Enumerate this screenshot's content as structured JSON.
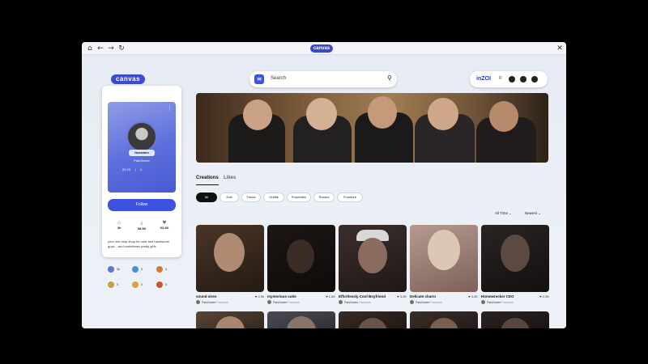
{
  "titlebar": {
    "home_icon": "home-icon",
    "back_icon": "arrow-left-icon",
    "forward_icon": "arrow-right-icon",
    "reload_icon": "reload-icon",
    "logo": "canvas",
    "close_icon": "close-icon"
  },
  "brand": "canvas",
  "search": {
    "placeholder": "Search"
  },
  "header": {
    "logo": "inZOI",
    "sub": "R"
  },
  "profile": {
    "nameplate": "Nazadam",
    "handle": "ParkSubee",
    "hero_followers": "20.7K",
    "hero_following": "4",
    "follow_label": "Follow",
    "stats": [
      {
        "icon": "creations-icon",
        "value": "3k"
      },
      {
        "icon": "downloads-icon",
        "value": "98.5K"
      },
      {
        "icon": "heart-icon",
        "value": "53.3K"
      }
    ],
    "bio": "your one stop shop for cute and handsome guys ...and sometimes pretty girls"
  },
  "badges": [
    {
      "color": "#5c78c8",
      "count": "3k"
    },
    {
      "color": "#4f8ad8",
      "count": "0"
    },
    {
      "color": "#d07a3a",
      "count": "0"
    },
    {
      "color": "#c7a23c",
      "count": "0"
    },
    {
      "color": "#e1a03c",
      "count": "0"
    },
    {
      "color": "#c65a2c",
      "count": "0"
    }
  ],
  "tabs": [
    "Creations",
    "Likes"
  ],
  "filters": [
    "All",
    "Zois",
    "Faces",
    "Outfits",
    "Properties",
    "Rooms",
    "Furniture"
  ],
  "sort": {
    "time": "All Time",
    "order": "Newest"
  },
  "cards": [
    {
      "title": "sound siren",
      "likes": "4.9k",
      "author": "ParkSubee",
      "tag": "Favorites"
    },
    {
      "title": "mysterious cutie",
      "likes": "1.6K",
      "author": "ParkSubee",
      "tag": "Favorites"
    },
    {
      "title": "Effortlessly Cool Boyfriend",
      "likes": "3.0K",
      "author": "ParkSubee",
      "tag": "Favorites"
    },
    {
      "title": "Delicate charm",
      "likes": "3.0K",
      "author": "ParkSubee",
      "tag": "Favorites"
    },
    {
      "title": "Homewrecker CEO",
      "likes": "2.9K",
      "author": "ParkSubee",
      "tag": "Favorites"
    }
  ]
}
